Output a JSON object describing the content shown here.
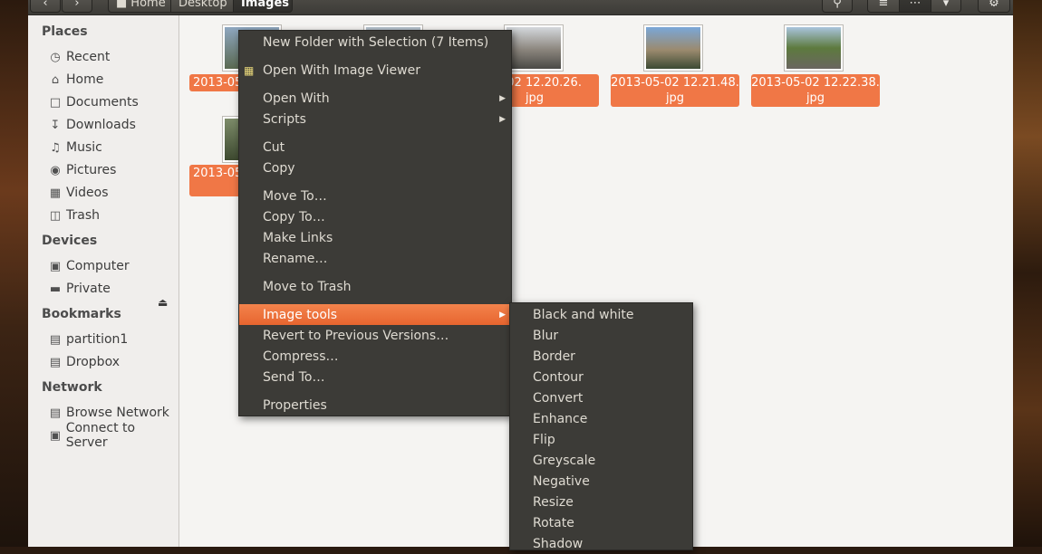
{
  "window": {
    "breadcrumb": [
      "Home",
      "Desktop",
      "Images"
    ],
    "nav": {
      "back_icon": "chevron-left-icon",
      "forward_icon": "chevron-right-icon"
    },
    "toolbar_icons": [
      "search-icon",
      "list-view-icon",
      "grid-view-icon",
      "dropdown-icon",
      "gear-icon"
    ]
  },
  "sidebar": {
    "places_title": "Places",
    "places": [
      {
        "label": "Recent",
        "icon": "clock-icon"
      },
      {
        "label": "Home",
        "icon": "home-icon"
      },
      {
        "label": "Documents",
        "icon": "document-icon"
      },
      {
        "label": "Downloads",
        "icon": "download-icon"
      },
      {
        "label": "Music",
        "icon": "music-icon"
      },
      {
        "label": "Pictures",
        "icon": "camera-icon"
      },
      {
        "label": "Videos",
        "icon": "film-icon"
      },
      {
        "label": "Trash",
        "icon": "trash-icon"
      }
    ],
    "devices_title": "Devices",
    "devices": [
      {
        "label": "Computer",
        "icon": "computer-icon"
      },
      {
        "label": "Private",
        "icon": "drive-icon"
      }
    ],
    "bookmarks_title": "Bookmarks",
    "bookmarks": [
      {
        "label": "partition1",
        "icon": "folder-icon"
      },
      {
        "label": "Dropbox",
        "icon": "folder-icon"
      }
    ],
    "network_title": "Network",
    "network": [
      {
        "label": "Browse Network",
        "icon": "network-icon"
      },
      {
        "label": "Connect to Server",
        "icon": "server-icon"
      }
    ]
  },
  "files": [
    {
      "label_line1": "2013-05",
      "label_line2": ""
    },
    {
      "label_line1": "",
      "label_line2": ""
    },
    {
      "label_line1": "05-02 12.20.26.",
      "label_line2": "jpg"
    },
    {
      "label_line1": "2013-05-02 12.21.48.",
      "label_line2": "jpg"
    },
    {
      "label_line1": "2013-05-02 12.22.38.",
      "label_line2": "jpg"
    },
    {
      "label_line1": "2013-05",
      "label_line2": ""
    }
  ],
  "context_menu": {
    "items": [
      "New Folder with Selection (7 Items)",
      "Open With Image Viewer",
      "Open With",
      "Scripts",
      "Cut",
      "Copy",
      "Move To…",
      "Copy To…",
      "Make Links",
      "Rename…",
      "Move to Trash",
      "Image tools",
      "Revert to Previous Versions…",
      "Compress…",
      "Send To…",
      "Properties"
    ],
    "highlighted": "Image tools"
  },
  "image_tools_submenu": {
    "items": [
      "Black and white",
      "Blur",
      "Border",
      "Contour",
      "Convert",
      "Enhance",
      "Flip",
      "Greyscale",
      "Negative",
      "Resize",
      "Rotate",
      "Shadow"
    ]
  },
  "colors": {
    "accent": "#f07746",
    "menu_bg": "#3c3b37",
    "highlight": "#ee6d36"
  }
}
